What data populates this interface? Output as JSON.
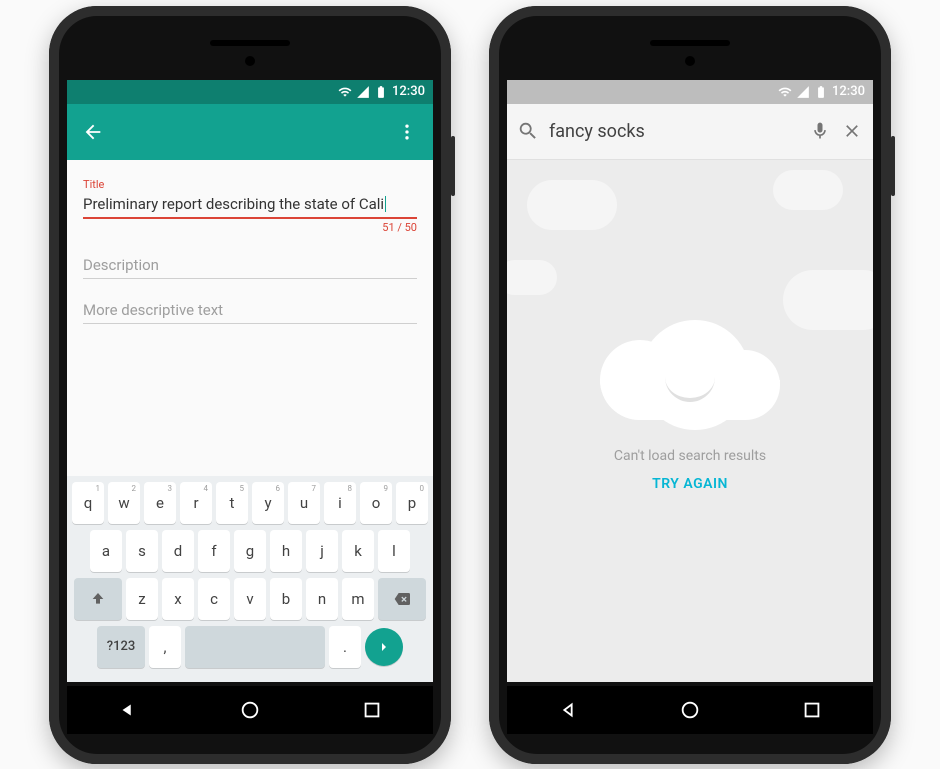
{
  "status": {
    "time": "12:30"
  },
  "phone1": {
    "appbar": {
      "back": "back",
      "overflow": "more"
    },
    "title_field": {
      "label": "Title",
      "value": "Preliminary report describing the state of Cali",
      "counter": "51 / 50"
    },
    "description_field": {
      "placeholder": "Description"
    },
    "more_field": {
      "placeholder": "More descriptive text"
    },
    "keyboard": {
      "row1": [
        "q",
        "w",
        "e",
        "r",
        "t",
        "y",
        "u",
        "i",
        "o",
        "p"
      ],
      "row1_sup": [
        "1",
        "2",
        "3",
        "4",
        "5",
        "6",
        "7",
        "8",
        "9",
        "0"
      ],
      "row2": [
        "a",
        "s",
        "d",
        "f",
        "g",
        "h",
        "j",
        "k",
        "l"
      ],
      "row3": [
        "z",
        "x",
        "c",
        "v",
        "b",
        "n",
        "m"
      ],
      "shift": "⇧",
      "backspace": "⌫",
      "sym": "?123",
      "comma": ",",
      "period": ".",
      "enter": "›"
    }
  },
  "phone2": {
    "search": {
      "query": "fancy socks"
    },
    "empty": {
      "message": "Can't load search results",
      "action": "TRY AGAIN"
    }
  }
}
